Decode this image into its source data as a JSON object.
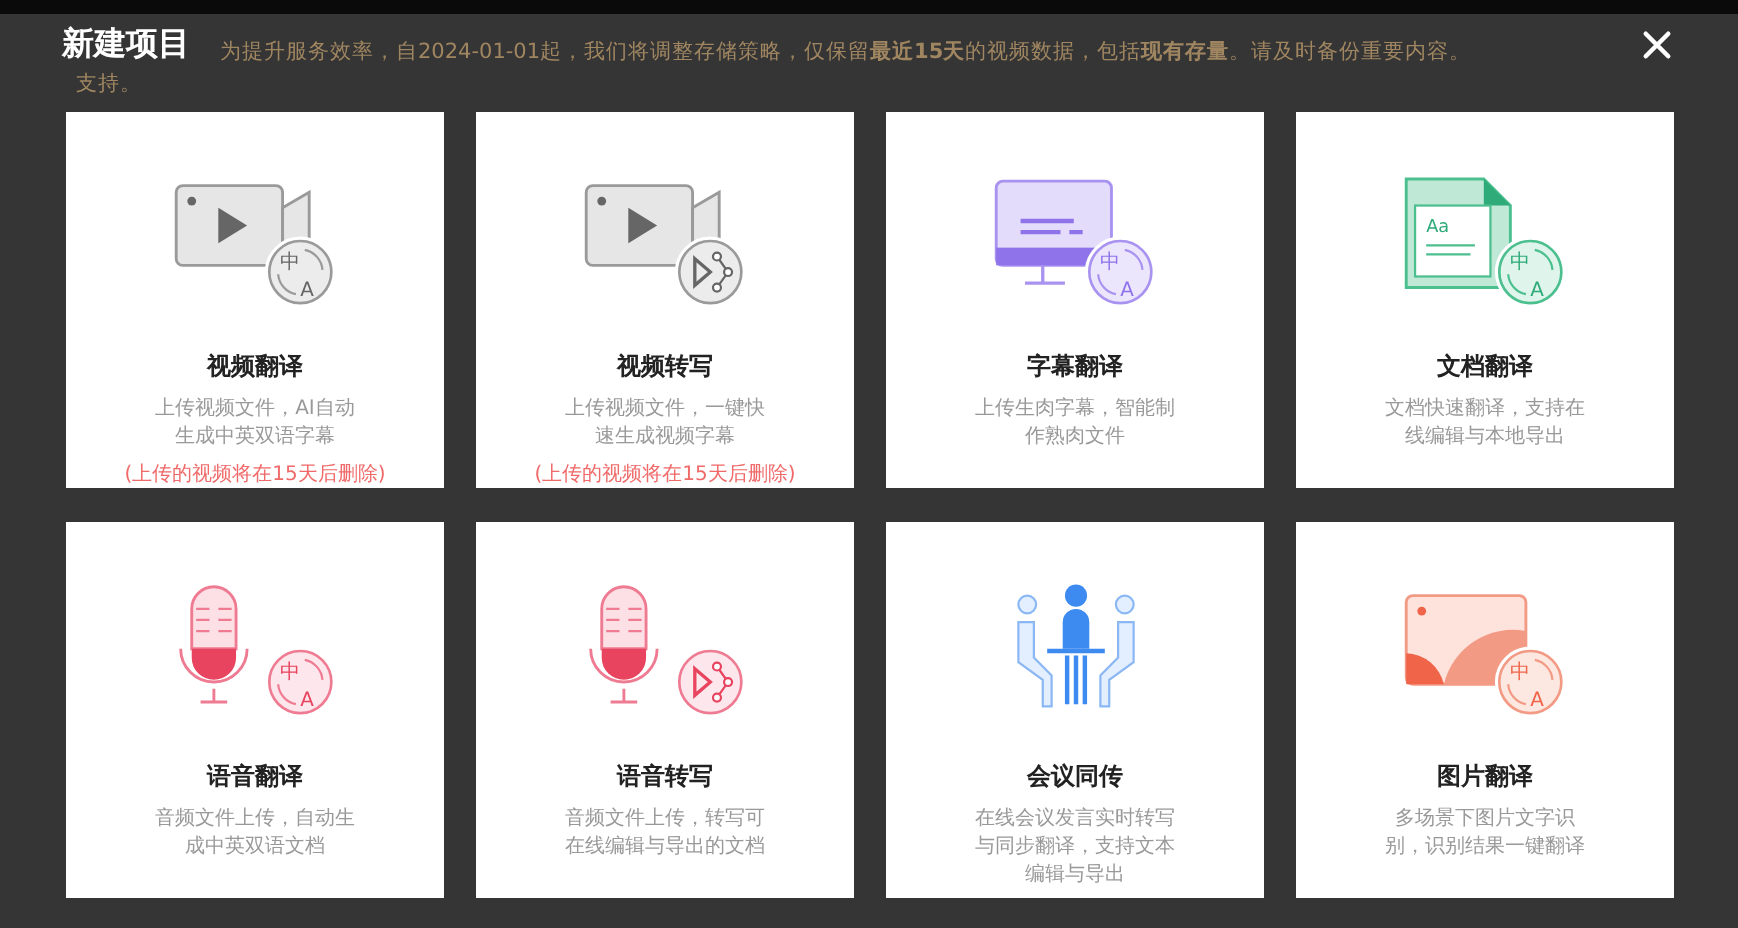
{
  "dialog": {
    "title": "新建项目"
  },
  "background_notice": {
    "line_1": "为提升服务效率，自2024-01-01起，我们将调整存储策略，仅保留**最近15天**的视频数据，包括**现有存量**。请及时备份重要内容。",
    "line_2": "支持。"
  },
  "cards": [
    {
      "kind": "video",
      "title": "视频翻译",
      "description": "上传视频文件，AI自动生成中英双语字幕",
      "warning": "(上传的视频将在15天后删除)",
      "badge": {
        "kind": "translate",
        "marks": [
          "中",
          "A"
        ]
      }
    },
    {
      "kind": "video",
      "title": "视频转写",
      "description": "上传视频文件，一键快速生成视频字幕",
      "warning": "(上传的视频将在15天后删除)",
      "badge": {
        "kind": "transcribe"
      }
    },
    {
      "kind": "monitor",
      "title": "字幕翻译",
      "description": "上传生肉字幕，智能制作熟肉文件",
      "badge": {
        "kind": "translate",
        "marks": [
          "中",
          "A"
        ]
      }
    },
    {
      "kind": "document",
      "title": "文档翻译",
      "description": "文档快速翻译，支持在线编辑与本地导出",
      "badge": {
        "kind": "translate",
        "marks": [
          "中",
          "A"
        ]
      },
      "doc_mark": "Aa"
    },
    {
      "kind": "microphone",
      "title": "语音翻译",
      "description": "音频文件上传，自动生成中英双语文档",
      "badge": {
        "kind": "translate",
        "marks": [
          "中",
          "A"
        ]
      }
    },
    {
      "kind": "microphone",
      "title": "语音转写",
      "description": "音频文件上传，转写可在线编辑与导出的文档",
      "badge": {
        "kind": "transcribe"
      }
    },
    {
      "kind": "meeting",
      "title": "会议同传",
      "description": "在线会议发言实时转写与同步翻译，支持文本编辑与导出"
    },
    {
      "kind": "picture",
      "title": "图片翻译",
      "description": "多场景下图片文字识别，识别结果一键翻译",
      "badge": {
        "kind": "translate",
        "marks": [
          "中",
          "A"
        ]
      }
    }
  ]
}
